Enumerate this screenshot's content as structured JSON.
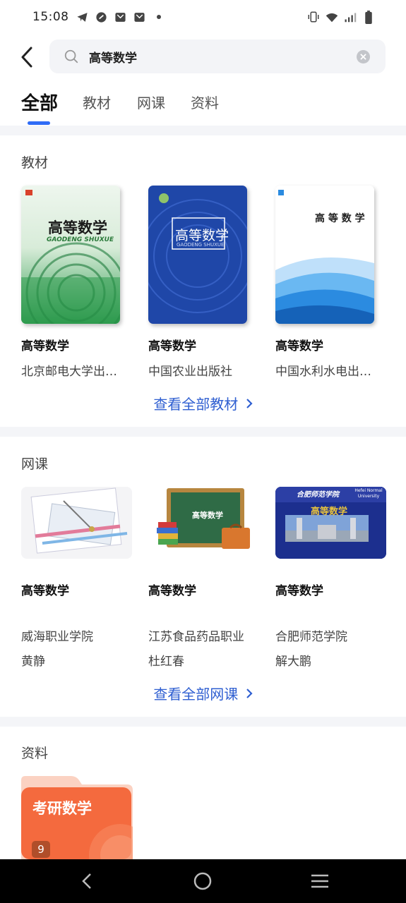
{
  "status_bar": {
    "time": "15:08"
  },
  "search": {
    "query": "高等数学"
  },
  "tabs": [
    {
      "label": "全部",
      "active": true
    },
    {
      "label": "教材"
    },
    {
      "label": "网课"
    },
    {
      "label": "资料"
    }
  ],
  "textbooks": {
    "section_title": "教材",
    "items": [
      {
        "title": "高等数学",
        "publisher": "北京邮电大学出版社",
        "cover_text": "高等数学",
        "cover_sub": "GAODENG SHUXUE",
        "cover_color": "#2e9b4e"
      },
      {
        "title": "高等数学",
        "publisher": "中国农业出版社",
        "cover_text": "高等数学",
        "cover_sub": "GAODENG SHUXUE",
        "cover_color": "#1f47a8"
      },
      {
        "title": "高等数学",
        "publisher": "中国水利水电出版社",
        "cover_text": "高 等 数 学",
        "cover_color": "#2b8be0"
      }
    ],
    "see_all": "查看全部教材"
  },
  "courses": {
    "section_title": "网课",
    "items": [
      {
        "title": "高等数学",
        "school": "威海职业学院",
        "teacher": "黄静"
      },
      {
        "title": "高等数学",
        "school": "江苏食品药品职业",
        "teacher": "杜红春",
        "board_text": "高等数学"
      },
      {
        "title": "高等数学",
        "school": "合肥师范学院",
        "teacher": "解大鹏",
        "banner_text": "高等数学",
        "banner_school": "合肥师范学院",
        "banner_english": "Hefei Normal University"
      }
    ],
    "see_all": "查看全部网课"
  },
  "materials": {
    "section_title": "资料",
    "items": [
      {
        "title": "考研数学",
        "count": "9"
      }
    ]
  },
  "colors": {
    "accent": "#2f6cf6",
    "link": "#2f5fd1",
    "folder": "#f46a3e"
  }
}
